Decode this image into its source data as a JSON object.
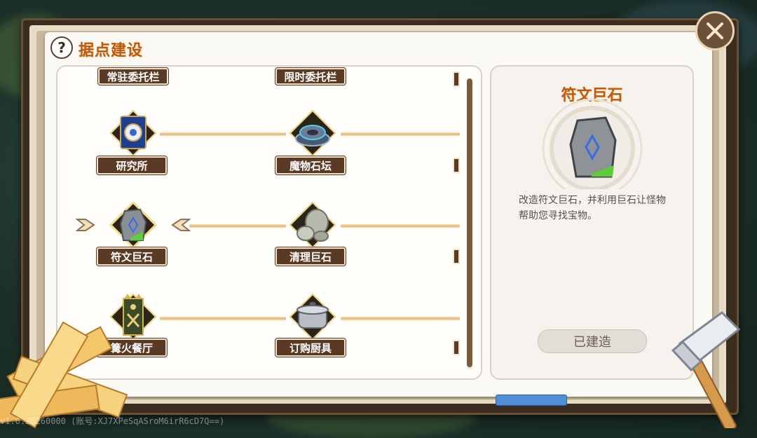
{
  "header": {
    "title": "据点建设",
    "help_icon": "?"
  },
  "tree": {
    "top_labels": [
      "常驻委托栏",
      "限时委托栏"
    ],
    "nodes": [
      {
        "label": "研究所",
        "icon": "research-book-icon"
      },
      {
        "label": "魔物石坛",
        "icon": "monster-altar-icon"
      },
      {
        "label": "符文巨石",
        "icon": "rune-stone-icon",
        "selected": true
      },
      {
        "label": "清理巨石",
        "icon": "boulder-icon"
      },
      {
        "label": "篝火餐厅",
        "icon": "campfire-banner-icon"
      },
      {
        "label": "订购厨具",
        "icon": "cooking-pot-icon"
      }
    ]
  },
  "detail": {
    "title": "符文巨石",
    "description": "改造符文巨石，并利用巨石让怪物帮助您寻找宝物。",
    "status_button": "已建造"
  },
  "footer": {
    "version": "v1.0.20260000  (账号:XJ7XPeSqASroM6irR6cD7Q==)"
  },
  "colors": {
    "title": "#c0570b",
    "label_bg": "#5a3a24",
    "accent_blue": "#4f8fd8"
  }
}
